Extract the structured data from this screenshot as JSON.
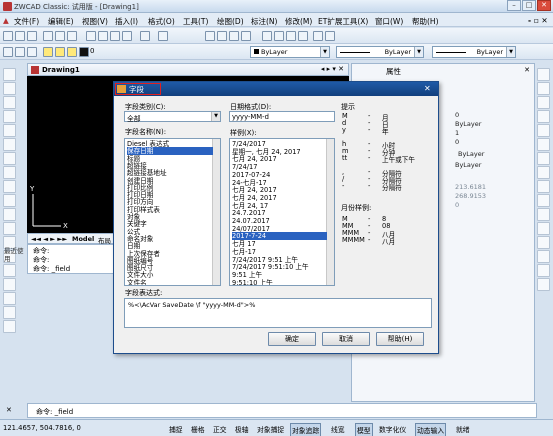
{
  "app": {
    "title": "ZWCAD Classic: 试用版 - [Drawing1]"
  },
  "menu": [
    "文件(F)",
    "编辑(E)",
    "视图(V)",
    "插入(I)",
    "格式(O)",
    "工具(T)",
    "绘图(D)",
    "标注(N)",
    "修改(M)",
    "ET扩展工具(X)",
    "窗口(W)",
    "帮助(H)"
  ],
  "toolbar2": {
    "layer": "0",
    "color": "ByLayer",
    "linetype": "ByLayer",
    "lineweight": "ByLayer"
  },
  "drawing": {
    "tab": "Drawing1"
  },
  "layout_tabs": [
    "Model",
    "布局"
  ],
  "cmd_lines": [
    "命令:",
    "命令:",
    "命令: _field"
  ],
  "side_label": "最近使用",
  "props": {
    "title": "属性",
    "values": [
      "0",
      "ByLayer",
      "1",
      "0",
      "ByLayer",
      "ByLayer",
      "213.6181",
      "268.9153",
      "0"
    ]
  },
  "dialog": {
    "title": "字段",
    "category_label": "字段类别(C):",
    "category_value": "全部",
    "names_label": "字段名称(N):",
    "names": [
      "Diesel 表达式",
      "保存日期",
      "标题",
      "超链接",
      "超链接基地址",
      "创建日期",
      "打印比例",
      "打印日期",
      "打印方向",
      "打印样式表",
      "对象",
      "关键字",
      "公式",
      "命名对象",
      "日期",
      "上次保存者",
      "图纸编号",
      "图纸尺寸",
      "文件大小",
      "文件名"
    ],
    "names_selected": 1,
    "date_format_label": "日期格式(D):",
    "date_format_value": "yyyy-MM-d",
    "examples_label": "样例(X):",
    "examples": [
      "7/24/2017",
      "星期一, 七月 24, 2017",
      "七月 24, 2017",
      "7/24/17",
      "2017-07-24",
      "24-七月-17",
      "七月 24, 2017",
      "七月 24, 2017",
      "七月 24, 17",
      "24.7.2017",
      "24.07.2017",
      "24/07/2017",
      "2017-7-24",
      "七月 17",
      "七月-17",
      "7/24/2017 9:51 上午",
      "7/24/2017 9:51:10 上午",
      "9:51 上午",
      "9:51:10 上午"
    ],
    "examples_selected": 12,
    "hints_label": "提示",
    "hints": [
      [
        "M",
        "-",
        "月"
      ],
      [
        "d",
        "-",
        "日"
      ],
      [
        "y",
        "-",
        "年"
      ],
      [
        "h",
        "-",
        "小时"
      ],
      [
        "m",
        "-",
        "分钟"
      ],
      [
        "tt",
        "-",
        "上午或下午"
      ],
      [
        ",",
        "-",
        "分隔符"
      ],
      [
        "/",
        "-",
        "分隔符"
      ],
      [
        "-",
        "-",
        "分隔符"
      ]
    ],
    "month_label": "月份样例:",
    "months": [
      [
        "M",
        "-",
        "8"
      ],
      [
        "MM",
        "-",
        "08"
      ],
      [
        "MMM",
        "-",
        "八月"
      ],
      [
        "MMMM",
        "-",
        "八月"
      ]
    ],
    "expr_label": "字段表达式:",
    "expr_value": "%<\\AcVar SaveDate \\f \"yyyy-MM-d\">%",
    "ok": "确定",
    "cancel": "取消",
    "help": "帮助(H)"
  },
  "cmd_bottom": "命令: _field",
  "coords": "121.4657, 504.7816, 0",
  "status": [
    "捕捉",
    "栅格",
    "正交",
    "极轴",
    "对象捕捉",
    "对象追踪",
    "线宽",
    "模型",
    "数字化仪",
    "动态输入",
    "就绪"
  ]
}
